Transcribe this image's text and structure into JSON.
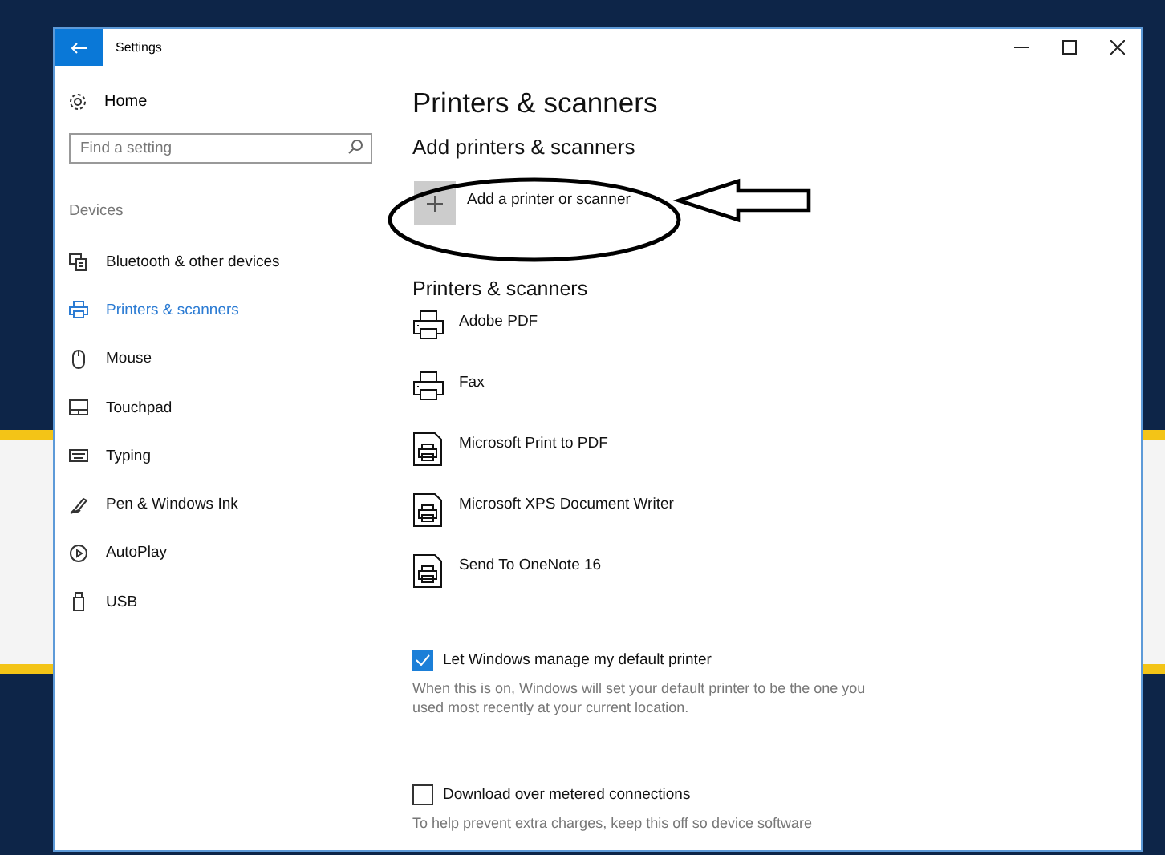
{
  "window": {
    "title": "Settings"
  },
  "sidebar": {
    "home": "Home",
    "search": {
      "placeholder": "Find a setting"
    },
    "section": "Devices",
    "items": [
      {
        "label": "Bluetooth & other devices",
        "kind": "bluetooth",
        "selected": false
      },
      {
        "label": "Printers & scanners",
        "kind": "printer",
        "selected": true
      },
      {
        "label": "Mouse",
        "kind": "mouse",
        "selected": false
      },
      {
        "label": "Touchpad",
        "kind": "touchpad",
        "selected": false
      },
      {
        "label": "Typing",
        "kind": "keyboard",
        "selected": false
      },
      {
        "label": "Pen & Windows Ink",
        "kind": "pen",
        "selected": false
      },
      {
        "label": "AutoPlay",
        "kind": "autoplay",
        "selected": false
      },
      {
        "label": "USB",
        "kind": "usb",
        "selected": false
      }
    ]
  },
  "content": {
    "title": "Printers & scanners",
    "add_heading": "Add printers & scanners",
    "add_button": "Add a printer or scanner",
    "list_heading": "Printers & scanners",
    "printers": [
      {
        "name": "Adobe PDF",
        "kind": "printer"
      },
      {
        "name": "Fax",
        "kind": "printer"
      },
      {
        "name": "Microsoft Print to PDF",
        "kind": "document"
      },
      {
        "name": "Microsoft XPS Document Writer",
        "kind": "document"
      },
      {
        "name": "Send To OneNote 16",
        "kind": "document"
      }
    ],
    "options": [
      {
        "label": "Let Windows manage my default printer",
        "checked": true,
        "description": "When this is on, Windows will set your default printer to be the one you used most recently at your current location."
      },
      {
        "label": "Download over metered connections",
        "checked": false,
        "description": "To help prevent extra charges, keep this off so device software"
      }
    ]
  }
}
